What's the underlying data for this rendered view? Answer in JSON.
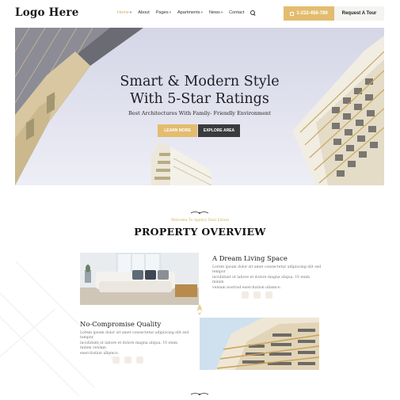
{
  "header": {
    "logo": "Logo Here",
    "nav": [
      {
        "label": "Home",
        "caret": true,
        "active": true
      },
      {
        "label": "About",
        "caret": false,
        "active": false
      },
      {
        "label": "Pages",
        "caret": true,
        "active": false
      },
      {
        "label": "Apartments",
        "caret": true,
        "active": false
      },
      {
        "label": "News",
        "caret": true,
        "active": false
      },
      {
        "label": "Contact",
        "caret": false,
        "active": false
      }
    ],
    "search_icon": "search-icon",
    "phone": "1-232-456-789",
    "phone_icon": "phone-icon",
    "tour_button": "Request A Tour"
  },
  "hero": {
    "title_line1": "Smart & Modern Style",
    "title_line2": "With 5-Star Ratings",
    "subtitle": "Best Architectures With Family- Friendly Environment",
    "learn_more": "LEARN MORE",
    "explore": "EXPLORE AREA"
  },
  "section": {
    "welcome": "Welcome To Agency Real Estate",
    "title": "PROPERTY OVERVIEW"
  },
  "rows": [
    {
      "title": "A Dream Living Space",
      "text": [
        "Lorem ipsum dolor sit amet consectetur adipiscing elit sed tempor",
        "incididunt ut labore et dolore magna aliqua. Ut enim minim",
        "veniam nostrud exercitation ullamco."
      ]
    },
    {
      "title": "No-Compromise Quality",
      "text": [
        "Lorem ipsum dolor sit amet consectetur adipiscing elit sed tempor",
        "incididunt ut labore et dolore magna aliqua. Ut enim minim veniam",
        "exercitation ullamco."
      ]
    }
  ],
  "colors": {
    "accent": "#e3bc6f",
    "dark_button": "#3a3b3d"
  }
}
